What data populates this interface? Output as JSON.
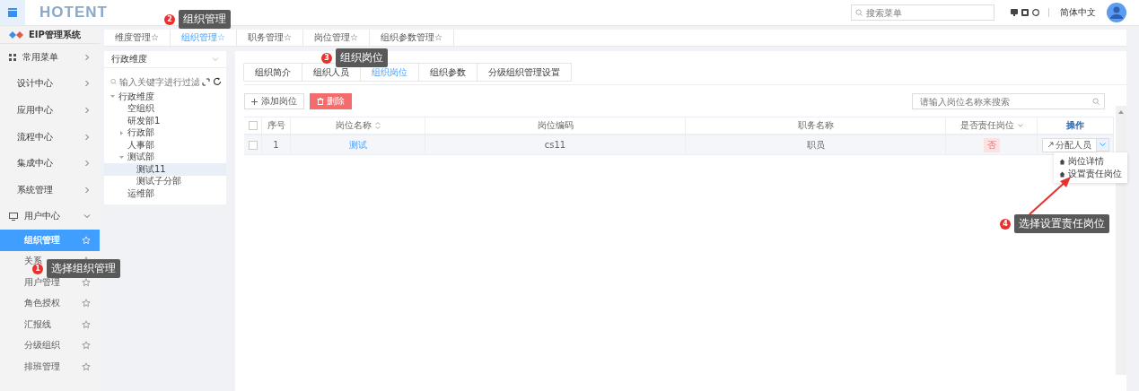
{
  "header": {
    "logo": "HOTENT",
    "search_placeholder": "搜索菜单",
    "language": "简体中文"
  },
  "sidebar": {
    "title": "EIP管理系统",
    "items": [
      {
        "label": "常用菜单",
        "kind": "grid",
        "expanded": false
      },
      {
        "label": "设计中心",
        "kind": "plain",
        "expanded": false
      },
      {
        "label": "应用中心",
        "kind": "plain",
        "expanded": false
      },
      {
        "label": "流程中心",
        "kind": "plain",
        "expanded": false
      },
      {
        "label": "集成中心",
        "kind": "plain",
        "expanded": false
      },
      {
        "label": "系统管理",
        "kind": "plain",
        "expanded": false
      },
      {
        "label": "用户中心",
        "kind": "monitor",
        "expanded": true,
        "children": [
          {
            "label": "组织管理",
            "selected": true
          },
          {
            "label": "关系",
            "selected": false
          },
          {
            "label": "用户管理",
            "selected": false
          },
          {
            "label": "角色授权",
            "selected": false
          },
          {
            "label": "汇报线",
            "selected": false
          },
          {
            "label": "分级组织",
            "selected": false
          },
          {
            "label": "排班管理",
            "selected": false
          }
        ]
      }
    ]
  },
  "tabs": [
    {
      "label": "维度管理☆",
      "selected": false
    },
    {
      "label": "组织管理☆",
      "selected": true
    },
    {
      "label": "职务管理☆",
      "selected": false
    },
    {
      "label": "岗位管理☆",
      "selected": false
    },
    {
      "label": "组织参数管理☆",
      "selected": false
    }
  ],
  "tree_panel": {
    "dimension": "行政维度",
    "filter_placeholder": "输入关键字进行过滤",
    "nodes": [
      {
        "label": "行政维度",
        "expanded": true,
        "selected": false,
        "children": [
          {
            "label": "空组织",
            "selected": false
          },
          {
            "label": "研发部1",
            "selected": false
          },
          {
            "label": "行政部",
            "expanded": false,
            "selected": false
          },
          {
            "label": "人事部",
            "selected": false
          },
          {
            "label": "测试部",
            "expanded": true,
            "selected": false,
            "children": [
              {
                "label": "测试11",
                "selected": true
              },
              {
                "label": "测试子分部",
                "selected": false
              }
            ]
          },
          {
            "label": "运维部",
            "selected": false
          }
        ]
      }
    ]
  },
  "sub_tabs": [
    {
      "label": "组织简介",
      "selected": false
    },
    {
      "label": "组织人员",
      "selected": false
    },
    {
      "label": "组织岗位",
      "selected": true
    },
    {
      "label": "组织参数",
      "selected": false
    },
    {
      "label": "分级组织管理设置",
      "selected": false
    }
  ],
  "toolbar": {
    "add_button": "添加岗位",
    "delete_button": "删除",
    "search_placeholder": "请输入岗位名称来搜索"
  },
  "table": {
    "header_checked": false,
    "columns": [
      {
        "label": "序号",
        "kind": "plain"
      },
      {
        "label": "岗位名称",
        "kind": "sort"
      },
      {
        "label": "岗位编码",
        "kind": "plain"
      },
      {
        "label": "职务名称",
        "kind": "plain"
      },
      {
        "label": "是否责任岗位",
        "kind": "filter"
      },
      {
        "label": "操作",
        "kind": "action"
      }
    ],
    "rows": [
      {
        "checked": false,
        "index": "1",
        "name": "测试",
        "code": "cs11",
        "job": "职员",
        "responsible": "否",
        "action": "分配人员"
      }
    ]
  },
  "dropdown_menu": [
    "岗位详情",
    "设置责任岗位"
  ],
  "callouts": [
    {
      "number": "1",
      "text": "选择组织管理"
    },
    {
      "number": "2",
      "text": "组织管理"
    },
    {
      "number": "3",
      "text": "组织岗位"
    },
    {
      "number": "4",
      "text": "选择设置责任岗位"
    }
  ]
}
